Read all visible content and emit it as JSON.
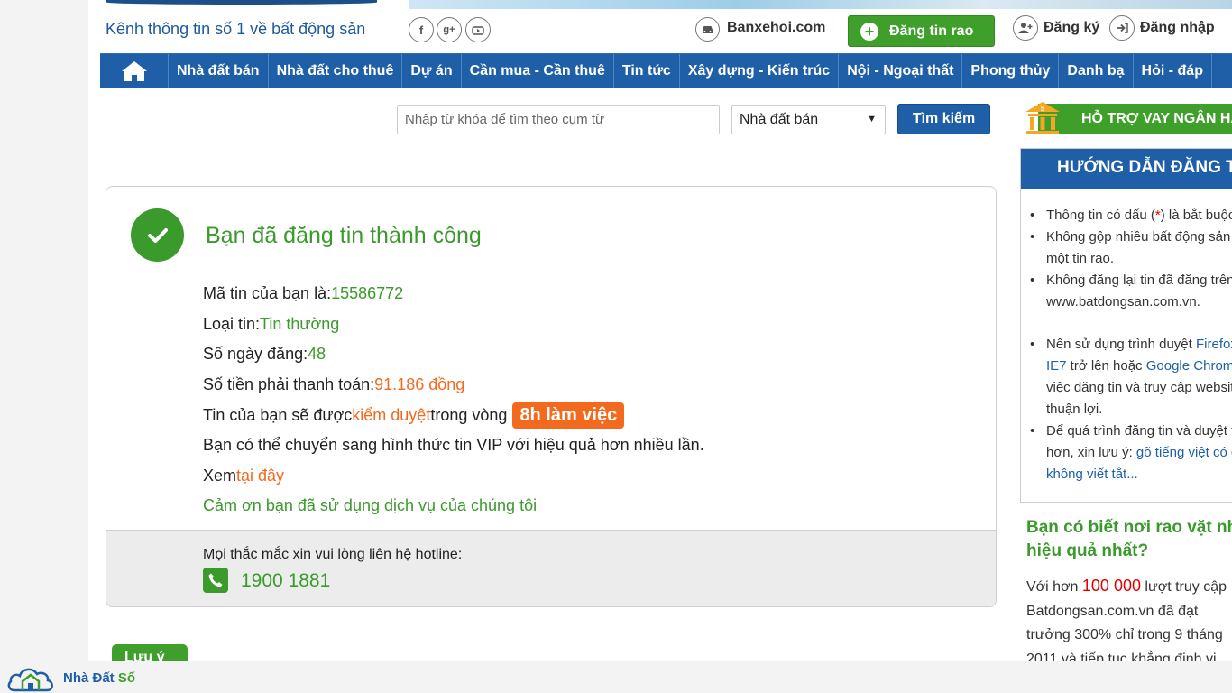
{
  "header": {
    "tagline": "Kênh thông tin số 1 về bất động sản",
    "social_icons": [
      "facebook-icon",
      "google-plus-icon",
      "youtube-icon"
    ],
    "banxehoi_label": "Banxehoi.com",
    "post_button_label": "Đăng tin rao",
    "register_label": "Đăng ký",
    "login_label": "Đăng nhập"
  },
  "nav": {
    "items": [
      "Nhà đất bán",
      "Nhà đất cho thuê",
      "Dự án",
      "Cần mua - Cần thuê",
      "Tin tức",
      "Xây dựng - Kiến trúc",
      "Nội - Ngoại thất",
      "Phong thủy",
      "Danh bạ",
      "Hỏi - đáp"
    ]
  },
  "search": {
    "placeholder": "Nhập từ khóa để tìm theo cụm từ",
    "category_selected": "Nhà đất bán",
    "button_label": "Tìm kiếm"
  },
  "success": {
    "title": "Bạn đã đăng tin thành công",
    "listing_id_label": "Mã tin của bạn là: ",
    "listing_id": "15586772",
    "listing_type_label": "Loại tin: ",
    "listing_type": "Tin thường",
    "days_label": "Số ngày đăng: ",
    "days": "48",
    "payment_label": "Số tiền phải thanh toán: ",
    "payment": "91.186 đồng",
    "review_prefix": "Tin của bạn sẽ được ",
    "review_link": "kiểm duyệt",
    "review_middle": " trong vòng",
    "review_badge": "8h làm việc",
    "vip_text": "Bạn có thể chuyển sang hình thức tin VIP với hiệu quả hơn nhiều lần.",
    "view_prefix": "Xem ",
    "view_link": "tại đây",
    "thanks": "Cảm ơn bạn đã sử dụng dịch vụ của chúng tôi",
    "hotline_label": "Mọi thắc mắc xin vui lòng liên hệ hotline:",
    "hotline_number": "1900 1881"
  },
  "partial_button_label": "Lưu ý",
  "sidebar": {
    "loan_banner": "HỖ TRỢ VAY NGÂN HÀNG",
    "guide_title": "HƯỚNG DẪN ĐĂNG TIN",
    "guide_items": {
      "i1_a": "Thông tin có dấu (",
      "i1_star": "*",
      "i1_b": ") là bắt buộc.",
      "i2": "Không gộp nhiều bất động sản trong",
      "i2_cont": "một tin rao.",
      "i3": "Không đăng lại tin đã đăng trên",
      "i3_cont": "www.batdongsan.com.vn.",
      "i4_a": "Nên sử dụng trình duyệt ",
      "i4_firefox": "Firefox",
      "i4_ie": "IE7",
      "i4_b": " trở lên hoặc ",
      "i4_chrome": "Google Chrome",
      "i4_c": "việc đăng tin và truy cập website",
      "i4_d": "thuận lợi.",
      "i5_a": "Để quá trình đăng tin và duyệt tin",
      "i5_b": "hơn, xin lưu ý: ",
      "i5_link1": "gõ tiếng việt có dấu,",
      "i5_link2": "không viết tắt..."
    },
    "know_title_1": "Bạn có biết nơi rao vặt nhà đất",
    "know_title_2": "hiệu quả nhất?",
    "know_l1_a": "Với hơn ",
    "know_l1_num": "100 000",
    "know_l1_b": " lượt truy cập",
    "know_l2": "Batdongsan.com.vn   đã   đạt",
    "know_l3": "trưởng 300% chỉ trong 9 tháng",
    "know_l4": "2011 và tiếp tục khẳng định vị"
  },
  "watermark": {
    "text_main": "Nhà Đất ",
    "text_accent": "Số"
  },
  "colors": {
    "brand_blue": "#1e5fa8",
    "success_green": "#3a9a2b",
    "accent_orange": "#f36a1f"
  }
}
